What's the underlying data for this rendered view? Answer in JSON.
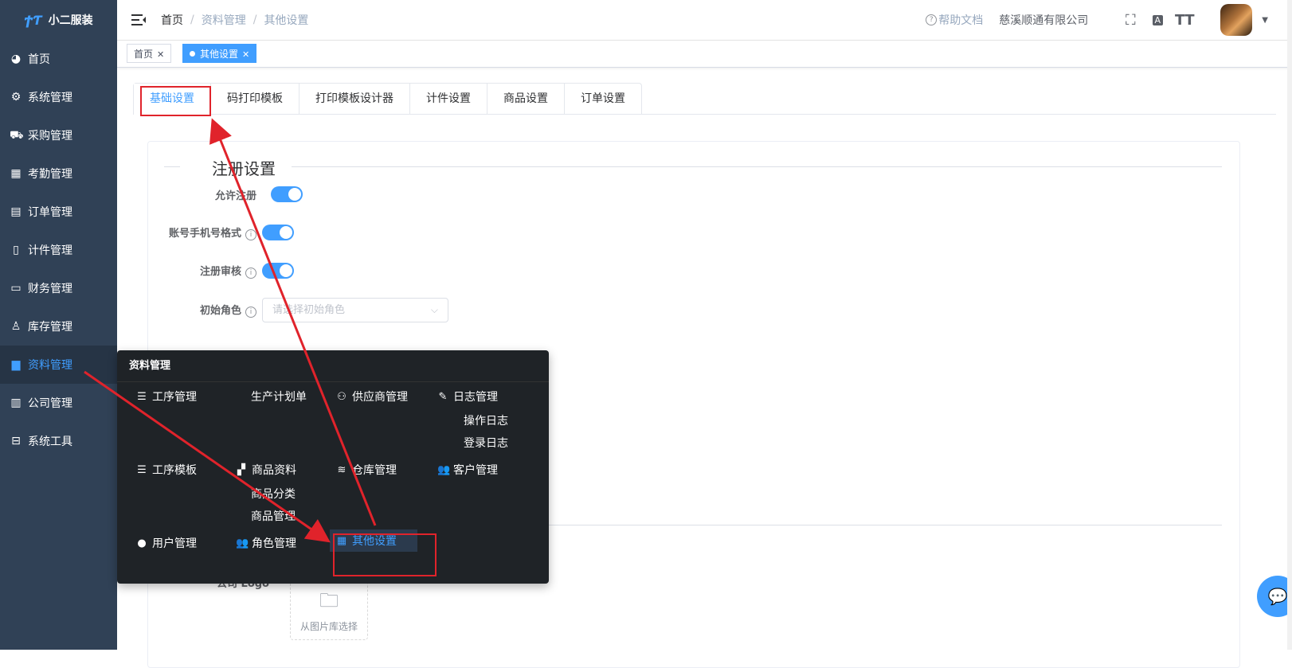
{
  "app": {
    "logo_mark": "ϮƬ",
    "name": "小二服装"
  },
  "sidebar": {
    "items": [
      {
        "label": "首页",
        "icon": "dashboard-icon"
      },
      {
        "label": "系统管理",
        "icon": "gear-icon"
      },
      {
        "label": "采购管理",
        "icon": "cart-icon"
      },
      {
        "label": "考勤管理",
        "icon": "grid-icon"
      },
      {
        "label": "订单管理",
        "icon": "order-icon"
      },
      {
        "label": "计件管理",
        "icon": "book-icon"
      },
      {
        "label": "财务管理",
        "icon": "monitor-icon"
      },
      {
        "label": "库存管理",
        "icon": "user-icon"
      },
      {
        "label": "资料管理",
        "icon": "document-icon"
      },
      {
        "label": "公司管理",
        "icon": "chart-icon"
      },
      {
        "label": "系统工具",
        "icon": "briefcase-icon"
      }
    ]
  },
  "navbar": {
    "breadcrumb": [
      "首页",
      "资料管理",
      "其他设置"
    ],
    "help": "帮助文档",
    "company": "慈溪顺通有限公司"
  },
  "tags": {
    "home": "首页",
    "current": "其他设置"
  },
  "tabs": [
    "基础设置",
    "码打印模板",
    "打印模板设计器",
    "计件设置",
    "商品设置",
    "订单设置"
  ],
  "form": {
    "section_title": "注册设置",
    "allow_register": "允许注册",
    "phone_format": "账号手机号格式",
    "register_review": "注册审核",
    "initial_role": "初始角色",
    "initial_role_placeholder": "请选择初始角色",
    "company_logo": "公司 Logo",
    "upload_text": "从图片库选择"
  },
  "flyout": {
    "title": "资料管理",
    "process_mgmt": "工序管理",
    "production_plan": "生产计划单",
    "supplier_mgmt": "供应商管理",
    "log_mgmt": "日志管理",
    "operation_log": "操作日志",
    "login_log": "登录日志",
    "process_template": "工序模板",
    "product_info": "商品资料",
    "warehouse_mgmt": "仓库管理",
    "customer_mgmt": "客户管理",
    "product_category": "商品分类",
    "product_mgmt": "商品管理",
    "user_mgmt": "用户管理",
    "role_mgmt": "角色管理",
    "other_settings": "其他设置"
  },
  "colors": {
    "sidebar_bg": "#304156",
    "accent": "#409eff",
    "annotation": "#e0232b",
    "flyout_bg": "#1f2327"
  }
}
